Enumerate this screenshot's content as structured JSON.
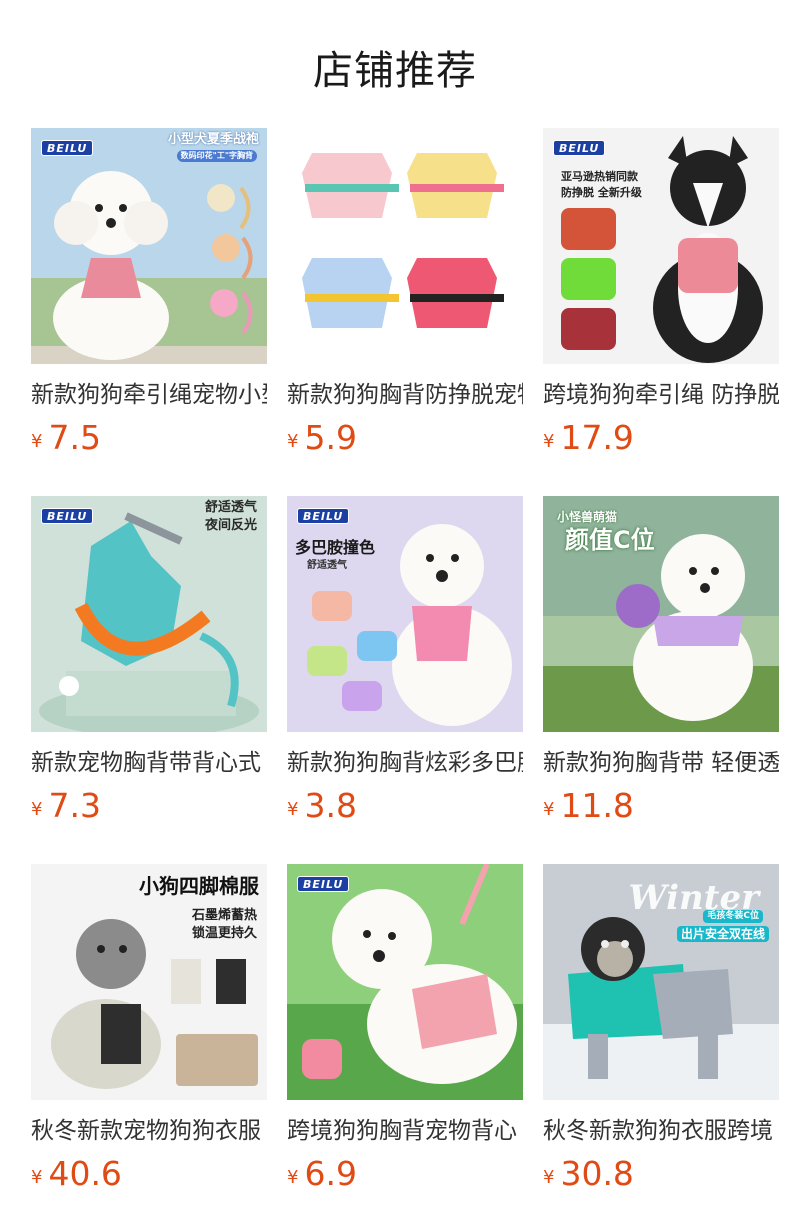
{
  "page": {
    "title": "店铺推荐"
  },
  "colors": {
    "price": "#e04b15",
    "brand_badge": "#1b3fa3"
  },
  "products": [
    {
      "name": "新款狗狗牵引绳宠物小型犬",
      "currency": "¥",
      "price": "7.5",
      "image": {
        "icon": "dog-harness-photo",
        "badge": "BEILU",
        "lines": [
          "小型犬夏季战袍",
          "数码印花\"工\"字胸背"
        ]
      }
    },
    {
      "name": "新款狗狗胸背防挣脱宠物",
      "currency": "¥",
      "price": "5.9",
      "image": {
        "icon": "pet-vest-photo",
        "badge": "",
        "lines": []
      }
    },
    {
      "name": "跨境狗狗牵引绳 防挣脱",
      "currency": "¥",
      "price": "17.9",
      "image": {
        "icon": "dog-harness-photo",
        "badge": "BEILU",
        "lines": [
          "亚马逊热销同款",
          "防挣脱 全新升级"
        ]
      }
    },
    {
      "name": "新款宠物胸背带背心式",
      "currency": "¥",
      "price": "7.3",
      "image": {
        "icon": "harness-leash-photo",
        "badge": "BEILU",
        "lines": [
          "舒适透气",
          "夜间反光"
        ]
      }
    },
    {
      "name": "新款狗狗胸背炫彩多巴胺",
      "currency": "¥",
      "price": "3.8",
      "image": {
        "icon": "dog-harness-photo",
        "badge": "BEILU",
        "lines": [
          "多巴胺撞色",
          "舒适透气"
        ]
      }
    },
    {
      "name": "新款狗狗胸背带 轻便透气",
      "currency": "¥",
      "price": "11.8",
      "image": {
        "icon": "dog-harness-photo",
        "badge": "",
        "lines": [
          "小怪兽萌猫",
          "颜值C位"
        ]
      }
    },
    {
      "name": "秋冬新款宠物狗狗衣服",
      "currency": "¥",
      "price": "40.6",
      "image": {
        "icon": "dog-coat-photo",
        "badge": "",
        "lines": [
          "小狗四脚棉服",
          "石墨烯蓄热",
          "锁温更持久"
        ]
      }
    },
    {
      "name": "跨境狗狗胸背宠物背心",
      "currency": "¥",
      "price": "6.9",
      "image": {
        "icon": "dog-harness-photo",
        "badge": "BEILU",
        "lines": []
      }
    },
    {
      "name": "秋冬新款狗狗衣服跨境",
      "currency": "¥",
      "price": "30.8",
      "image": {
        "icon": "dog-coat-photo",
        "badge": "",
        "lines": [
          "Winter",
          "毛孩冬装C位",
          "出片安全双在线"
        ]
      }
    }
  ]
}
